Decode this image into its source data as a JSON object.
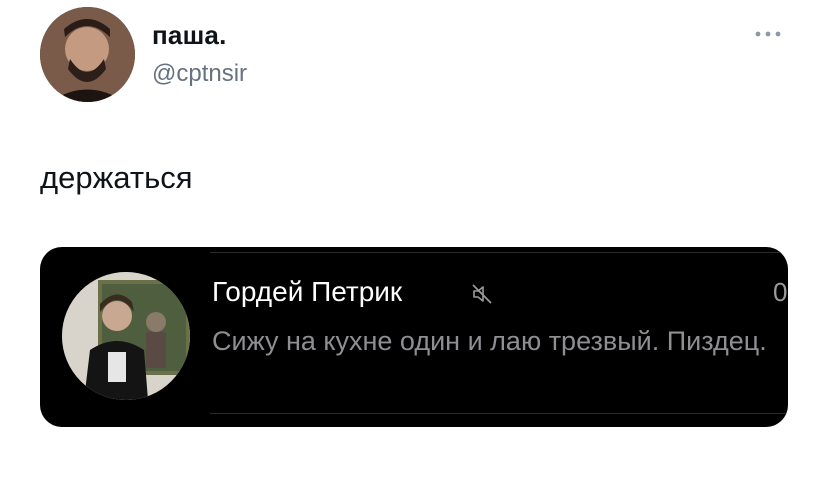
{
  "tweet": {
    "author": {
      "display_name": "паша.",
      "handle": "@cptnsir",
      "avatar_icon": "user-avatar"
    },
    "text": "держаться",
    "more_icon": "more-horizontal-icon"
  },
  "media": {
    "sender_name": "Гордей Петрик",
    "muted_icon": "muted-icon",
    "counter": "0",
    "message": "Сижу на кухне один и лаю трезвый. Пиздец."
  },
  "colors": {
    "text_primary": "#0f1419",
    "text_secondary": "#66727f",
    "media_bg": "#000000",
    "media_text_secondary": "#8e8e93"
  }
}
